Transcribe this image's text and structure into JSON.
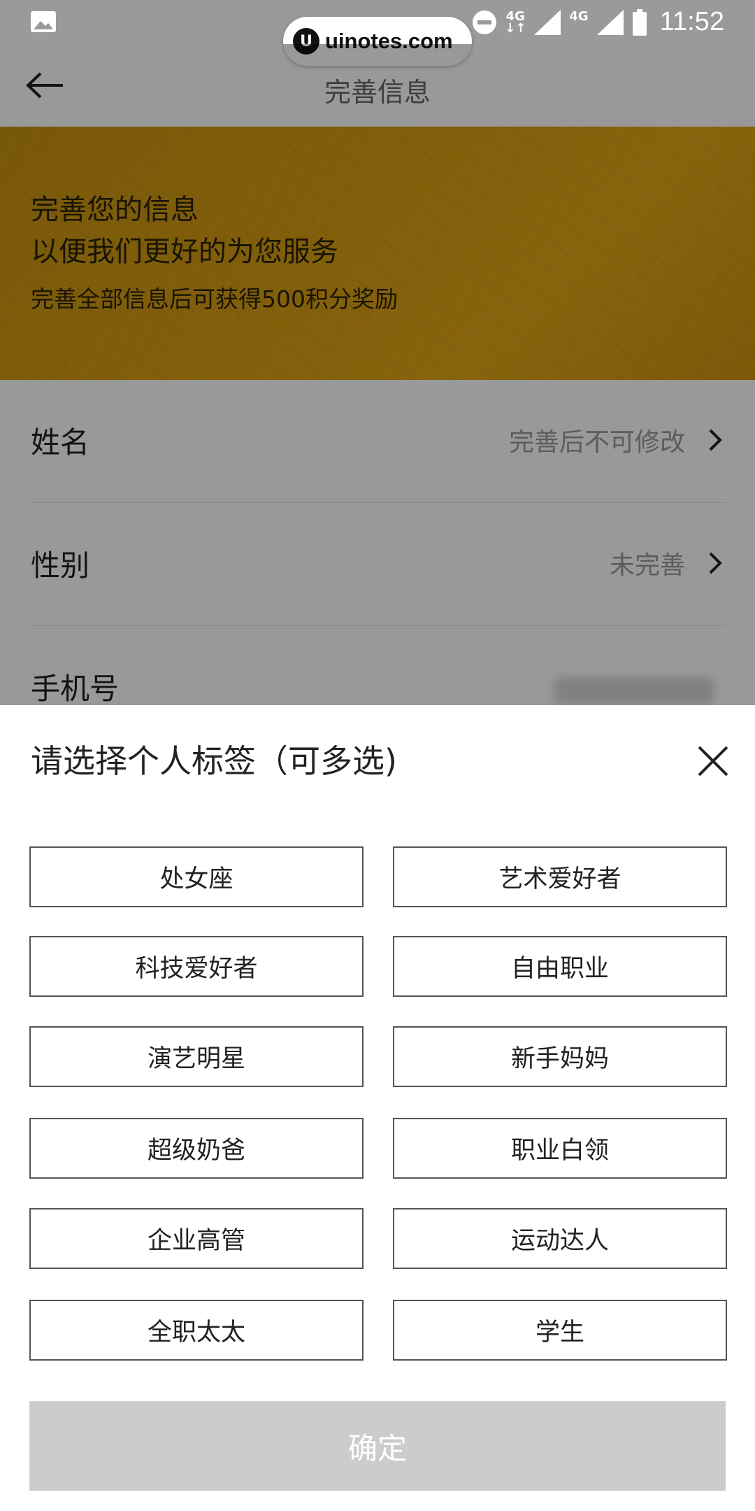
{
  "status_bar": {
    "time": "11:52",
    "network_1": "4G",
    "network_2": "4G"
  },
  "watermark": {
    "logo": "U",
    "text": "uinotes.com"
  },
  "header": {
    "title": "完善信息"
  },
  "banner": {
    "line1": "完善您的信息",
    "line2": "以便我们更好的为您服务",
    "line3": "完善全部信息后可获得500积分奖励"
  },
  "form": {
    "rows": [
      {
        "label": "姓名",
        "value": "完善后不可修改"
      },
      {
        "label": "性别",
        "value": "未完善"
      },
      {
        "label": "手机号",
        "value": ""
      }
    ]
  },
  "sheet": {
    "title": "请选择个人标签（可多选)",
    "tags": [
      "处女座",
      "艺术爱好者",
      "科技爱好者",
      "自由职业",
      "演艺明星",
      "新手妈妈",
      "超级奶爸",
      "职业白领",
      "企业高管",
      "运动达人",
      "全职太太",
      "学生"
    ],
    "confirm_label": "确定"
  },
  "colors": {
    "banner_accent": "#d99e12",
    "confirm_disabled": "#cccccc",
    "status_bar": "#9a9a9a"
  }
}
